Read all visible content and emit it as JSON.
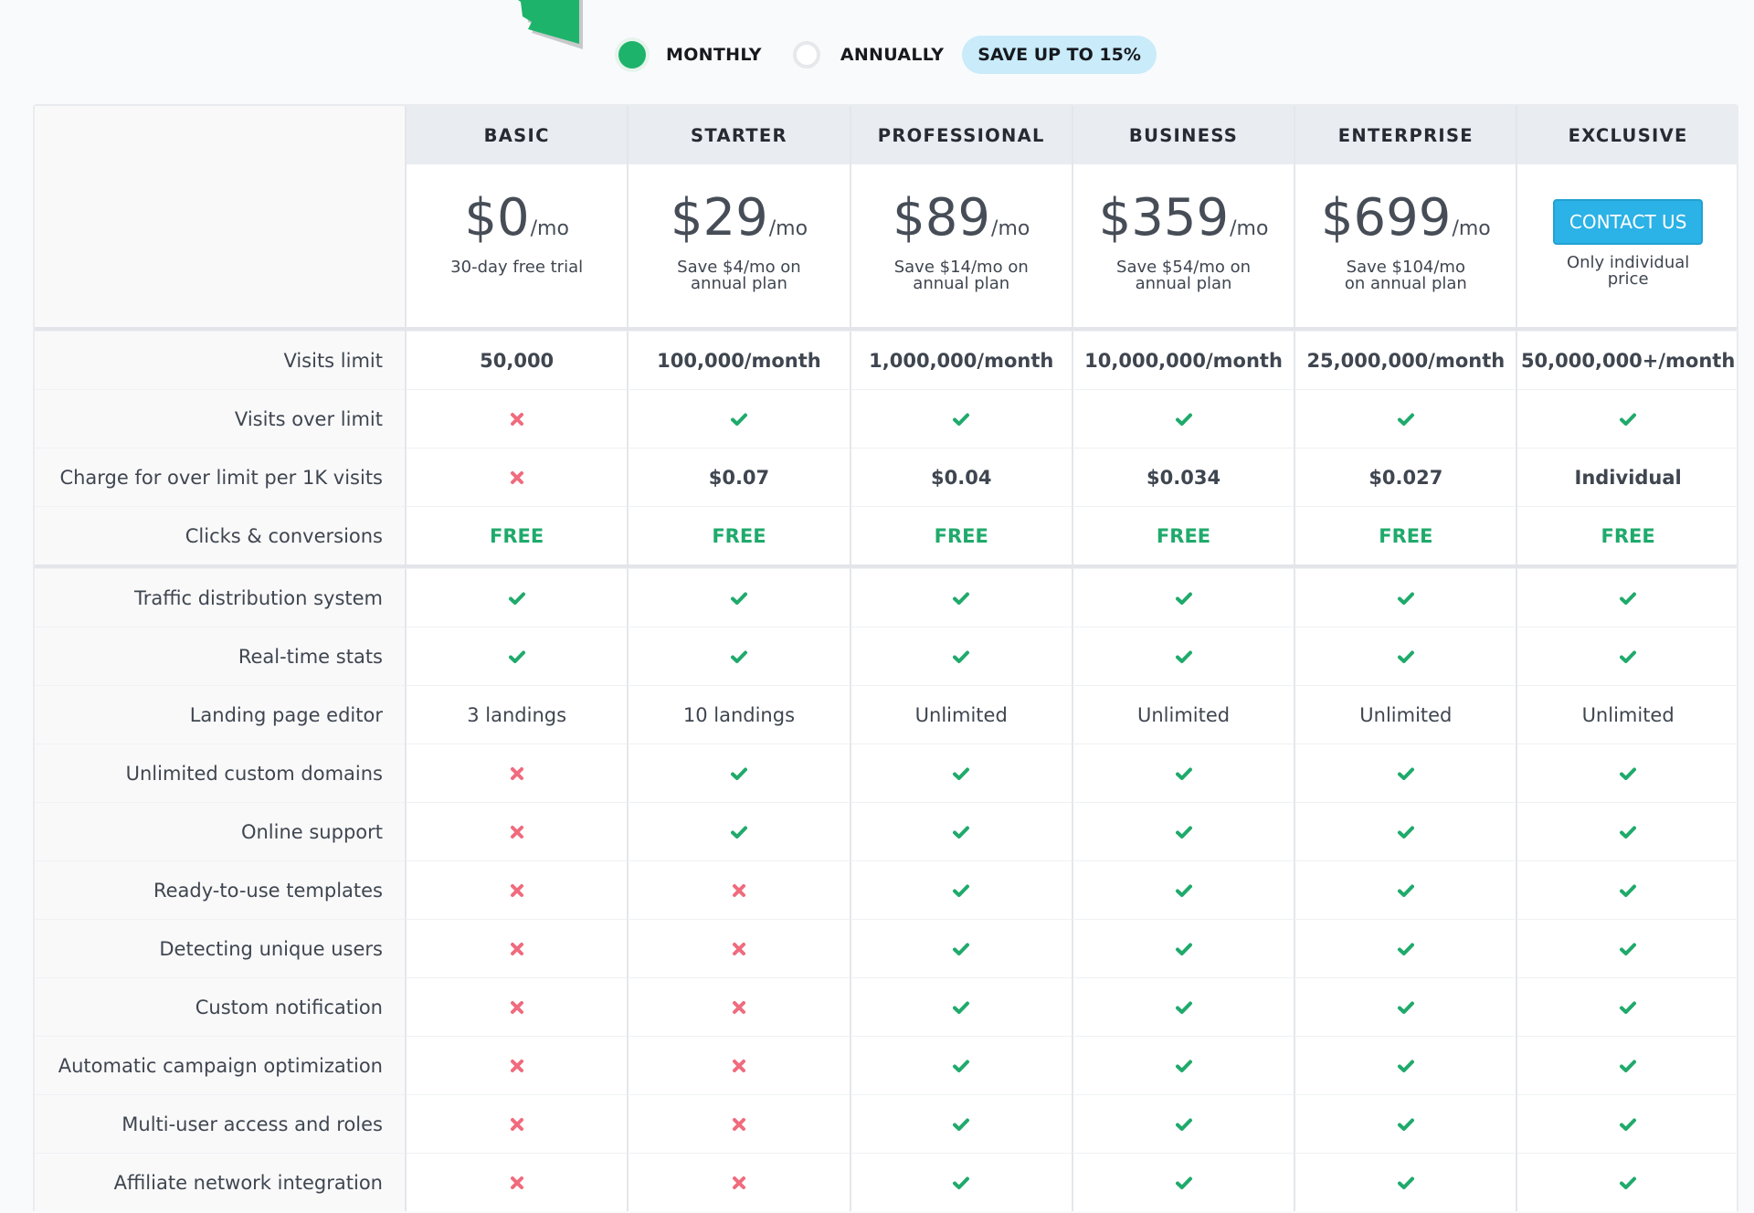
{
  "billing_toggle": {
    "options": [
      {
        "label": "MONTHLY",
        "selected": true
      },
      {
        "label": "ANNUALLY",
        "selected": false
      }
    ],
    "save_badge": "SAVE UP TO 15%"
  },
  "colors": {
    "accent_green": "#1eb36b",
    "check_green": "#1faa6b",
    "cross_red": "#f06b7d",
    "contact_blue": "#2bb2e6",
    "badge_blue": "#c9ebfa",
    "header_bg": "#e9ecf1"
  },
  "plans": [
    {
      "name": "BASIC",
      "price": "$0",
      "period": "/mo",
      "note": "30-day free trial"
    },
    {
      "name": "STARTER",
      "price": "$29",
      "period": "/mo",
      "note": "Save $4/mo on annual plan"
    },
    {
      "name": "PROFESSIONAL",
      "price": "$89",
      "period": "/mo",
      "note": "Save $14/mo on annual plan"
    },
    {
      "name": "BUSINESS",
      "price": "$359",
      "period": "/mo",
      "note": "Save $54/mo on annual plan"
    },
    {
      "name": "ENTERPRISE",
      "price": "$699",
      "period": "/mo",
      "note": "Save $104/mo on annual plan"
    },
    {
      "name": "EXCLUSIVE",
      "button": "CONTACT US",
      "note": "Only individual price"
    }
  ],
  "sections": [
    {
      "rows": [
        {
          "label": "Visits limit",
          "style": "bold",
          "values": [
            "50,000",
            "100,000/month",
            "1,000,000/month",
            "10,000,000/month",
            "25,000,000/month",
            "50,000,000+/month"
          ]
        },
        {
          "label": "Visits over limit",
          "values": [
            "cross",
            "check",
            "check",
            "check",
            "check",
            "check"
          ]
        },
        {
          "label": "Charge for over limit per 1K visits",
          "style": "bold",
          "values": [
            "cross",
            "$0.07",
            "$0.04",
            "$0.034",
            "$0.027",
            "Individual"
          ]
        },
        {
          "label": "Clicks & conversions",
          "style": "free",
          "values": [
            "FREE",
            "FREE",
            "FREE",
            "FREE",
            "FREE",
            "FREE"
          ]
        }
      ]
    },
    {
      "rows": [
        {
          "label": "Traffic distribution system",
          "values": [
            "check",
            "check",
            "check",
            "check",
            "check",
            "check"
          ]
        },
        {
          "label": "Real-time stats",
          "values": [
            "check",
            "check",
            "check",
            "check",
            "check",
            "check"
          ]
        },
        {
          "label": "Landing page editor",
          "values": [
            "3 landings",
            "10 landings",
            "Unlimited",
            "Unlimited",
            "Unlimited",
            "Unlimited"
          ]
        },
        {
          "label": "Unlimited custom domains",
          "values": [
            "cross",
            "check",
            "check",
            "check",
            "check",
            "check"
          ]
        },
        {
          "label": "Online support",
          "values": [
            "cross",
            "check",
            "check",
            "check",
            "check",
            "check"
          ]
        },
        {
          "label": "Ready-to-use templates",
          "values": [
            "cross",
            "cross",
            "check",
            "check",
            "check",
            "check"
          ]
        },
        {
          "label": "Detecting unique users",
          "values": [
            "cross",
            "cross",
            "check",
            "check",
            "check",
            "check"
          ]
        },
        {
          "label": "Custom notification",
          "values": [
            "cross",
            "cross",
            "check",
            "check",
            "check",
            "check"
          ]
        },
        {
          "label": "Automatic campaign optimization",
          "values": [
            "cross",
            "cross",
            "check",
            "check",
            "check",
            "check"
          ]
        },
        {
          "label": "Multi-user access and roles",
          "values": [
            "cross",
            "cross",
            "check",
            "check",
            "check",
            "check"
          ]
        },
        {
          "label": "Affiliate network integration",
          "values": [
            "cross",
            "cross",
            "check",
            "check",
            "check",
            "check"
          ]
        }
      ]
    }
  ]
}
